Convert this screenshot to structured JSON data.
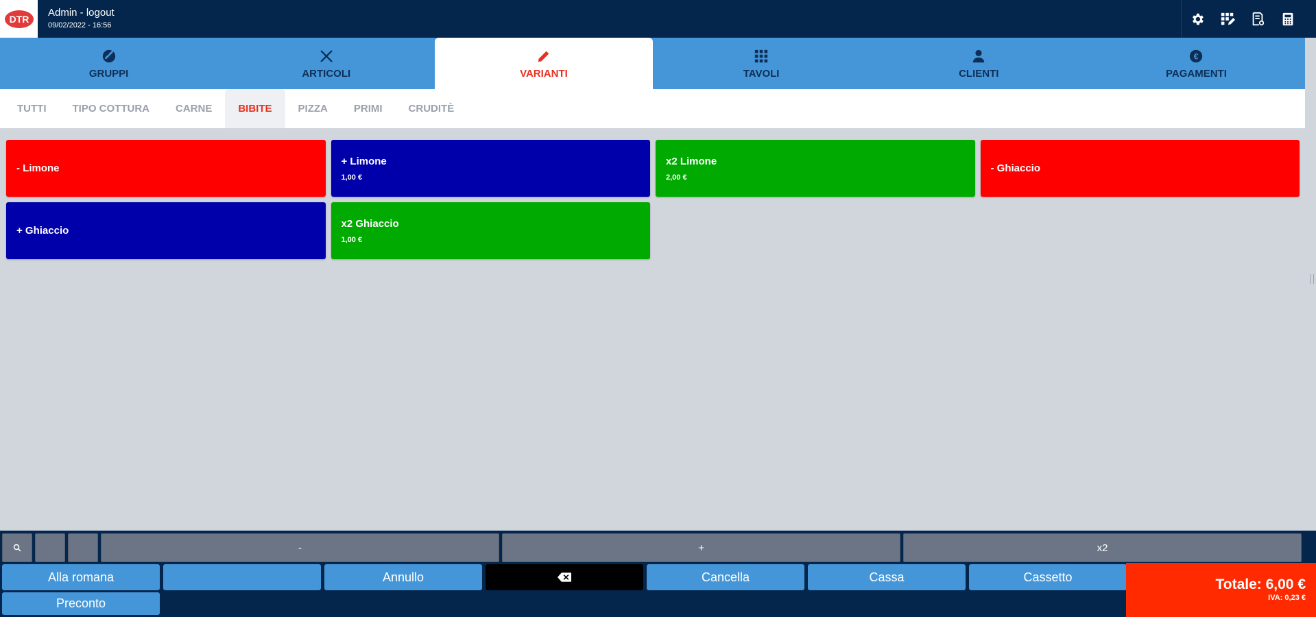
{
  "header": {
    "logo_text": "DTR",
    "user_label": "Admin - logout",
    "datetime": "09/02/2022 - 16:56",
    "icons": [
      "gear-icon",
      "grid-edit-icon",
      "receipt-icon",
      "calculator-icon"
    ]
  },
  "main_tabs": [
    {
      "label": "GRUPPI",
      "icon": "link-icon",
      "active": false
    },
    {
      "label": "ARTICOLI",
      "icon": "cutlery-icon",
      "active": false
    },
    {
      "label": "VARIANTI",
      "icon": "pencil-icon",
      "active": true
    },
    {
      "label": "TAVOLI",
      "icon": "grid-icon",
      "active": false
    },
    {
      "label": "CLIENTI",
      "icon": "person-icon",
      "active": false
    },
    {
      "label": "PAGAMENTI",
      "icon": "euro-icon",
      "active": false
    }
  ],
  "sub_tabs": [
    {
      "label": "TUTTI",
      "active": false
    },
    {
      "label": "TIPO COTTURA",
      "active": false
    },
    {
      "label": "CARNE",
      "active": false
    },
    {
      "label": "BIBITE",
      "active": true
    },
    {
      "label": "PIZZA",
      "active": false
    },
    {
      "label": "PRIMI",
      "active": false
    },
    {
      "label": "CRUDITÈ",
      "active": false
    }
  ],
  "variants": [
    {
      "name": "- Limone",
      "price": "",
      "color": "#ff0000"
    },
    {
      "name": "+ Limone",
      "price": "1,00 €",
      "color": "#0000aa"
    },
    {
      "name": "x2 Limone",
      "price": "2,00 €",
      "color": "#00aa00"
    },
    {
      "name": "- Ghiaccio",
      "price": "",
      "color": "#ff0000"
    },
    {
      "name": "+ Ghiaccio",
      "price": "",
      "color": "#0000aa"
    },
    {
      "name": "x2 Ghiaccio",
      "price": "1,00 €",
      "color": "#00aa00"
    }
  ],
  "keypad": {
    "search_icon": "search-icon",
    "minus": "-",
    "plus": "+",
    "x2": "x2"
  },
  "function_buttons": {
    "alla_romana": "Alla romana",
    "empty": "",
    "annullo": "Annullo",
    "backspace_icon": "backspace-icon",
    "cancella": "Cancella",
    "cassa": "Cassa",
    "cassetto": "Cassetto",
    "preconto": "Preconto"
  },
  "totals": {
    "total": "Totale: 6,00 €",
    "iva": "IVA: 0,23 €"
  },
  "colors": {
    "navy": "#04264c",
    "tab_blue": "#4596d8",
    "accent_red": "#e8301f",
    "total_red": "#ff2a00"
  }
}
